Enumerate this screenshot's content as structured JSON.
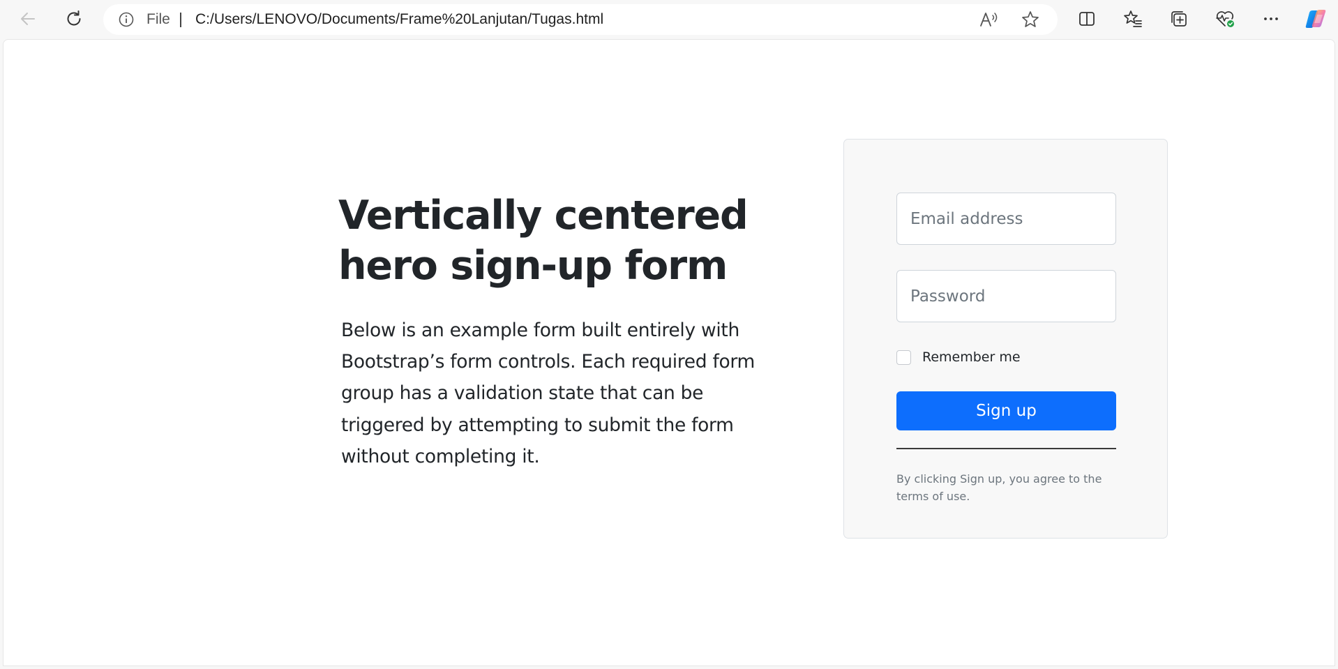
{
  "browser": {
    "address_bar": {
      "scheme_label": "File",
      "url": "C:/Users/LENOVO/Documents/Frame%20Lanjutan/Tugas.html"
    },
    "icons": {
      "back": "back-arrow-icon",
      "refresh": "refresh-icon",
      "info": "info-icon",
      "read_aloud": "read-aloud-icon",
      "favorite": "star-icon",
      "split_screen": "split-screen-icon",
      "favorites": "favorites-list-icon",
      "collections": "collections-icon",
      "browser_essentials": "heartbeat-icon",
      "more": "more-icon",
      "copilot": "copilot-icon"
    }
  },
  "hero": {
    "title": "Vertically centered hero sign-up form",
    "description": "Below is an example form built entirely with Bootstrap’s form controls. Each required form group has a validation state that can be triggered by attempting to submit the form without completing it."
  },
  "form": {
    "email_placeholder": "Email address",
    "email_value": "",
    "password_placeholder": "Password",
    "password_value": "",
    "remember_label": "Remember me",
    "remember_checked": false,
    "submit_label": "Sign up",
    "terms_text": "By clicking Sign up, you agree to the terms of use."
  },
  "colors": {
    "primary": "#0d6efd",
    "card_bg": "#f8f8f8",
    "muted_text": "#6c757d",
    "body_text": "#212529"
  }
}
